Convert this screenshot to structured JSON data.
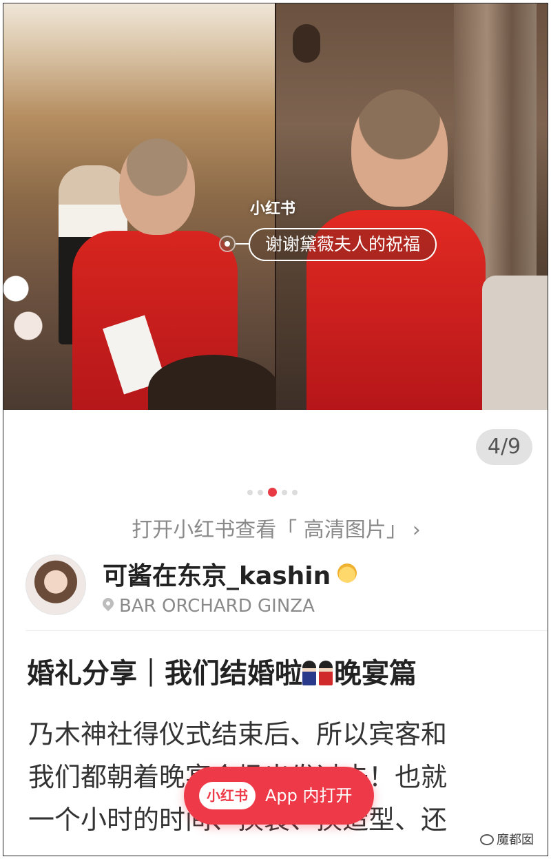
{
  "hero": {
    "watermark": "小红书",
    "caption": "谢谢黛薇夫人的祝福",
    "counter": "4/9"
  },
  "pagination": {
    "total_dots": 5,
    "active_index": 2
  },
  "open_hd": {
    "label": "打开小红书查看「 高清图片」",
    "chevron": "›"
  },
  "author": {
    "name": "可酱在东京_kashin",
    "location": "BAR ORCHARD GINZA"
  },
  "post": {
    "title_prefix": "婚礼分享｜我们结婚啦",
    "title_suffix": "晚宴篇",
    "body_lines": [
      "乃木神社得仪式结束后、所以宾客和",
      "我们都朝着晚宴会场出发过去！也就",
      "一个小时的时间、换装、换造型、还"
    ]
  },
  "app_button": {
    "logo": "小红书",
    "label": "App 内打开"
  },
  "corner_watermark": "魔都囡",
  "colors": {
    "accent": "#ee3a48",
    "dot_active": "#e83a45",
    "text_primary": "#222222",
    "text_secondary": "#8a8a8a"
  }
}
